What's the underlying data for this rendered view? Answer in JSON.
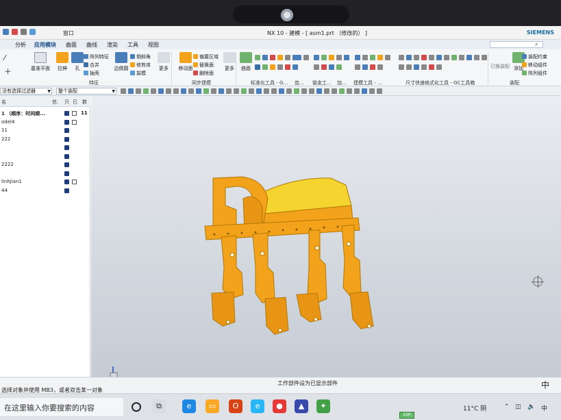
{
  "window": {
    "window_menu": "窗口",
    "title": "NX 10 - 建模 - [ asm1.prt （修改的） ]",
    "brand": "SIEMENS"
  },
  "menubar": {
    "items": [
      "分析",
      "应用模块",
      "曲面",
      "曲线",
      "渲染",
      "工具",
      "视图"
    ],
    "active_index": 1
  },
  "ribbon": {
    "groups": [
      {
        "label": "特征"
      },
      {
        "label": "同步建模"
      },
      {
        "label": "标准化工具 - G..."
      },
      {
        "label": "齿..."
      },
      {
        "label": "钣金工..."
      },
      {
        "label": "加..."
      },
      {
        "label": "建模工具 - ..."
      },
      {
        "label": "尺寸快速格式化工具 - GC工具箱"
      },
      {
        "label": "装配"
      }
    ],
    "feature_big": [
      {
        "label": "基准平面",
        "icon": "datum-plane-icon"
      },
      {
        "label": "拉伸",
        "icon": "extrude-icon"
      },
      {
        "label": "孔",
        "icon": "hole-icon"
      }
    ],
    "feature_small": [
      "阵列特征",
      "合并",
      "抽壳"
    ],
    "feature_small2": [
      "边倒圆"
    ],
    "feature_small3": [
      "倒斜角",
      "修剪体",
      "拔模"
    ],
    "more_label": "更多",
    "sync": {
      "big": "移动面",
      "small": [
        "偏置区域",
        "替换面",
        "删除面"
      ],
      "more": "更多"
    },
    "surface_label": "曲面",
    "assembly_small": [
      "装配约束",
      "移动组件",
      "阵列组件"
    ],
    "assembly_big": [
      "已换装配",
      "添加"
    ]
  },
  "selection_bar": {
    "filter_combo": "没有选择过滤器",
    "scope_combo": "整个装配"
  },
  "navigator": {
    "headers": [
      "名",
      "信.",
      "只",
      "已",
      "数"
    ],
    "rows": [
      {
        "name": "1 （顺序：时间顺...",
        "bold": true,
        "c3": "11"
      },
      {
        "name": "odel4",
        "bold": false,
        "c3": ""
      },
      {
        "name": "11",
        "bold": false,
        "c3": ""
      },
      {
        "name": "222",
        "bold": false,
        "c3": ""
      },
      {
        "name": "",
        "bold": false,
        "c3": ""
      },
      {
        "name": "",
        "bold": false,
        "c3": ""
      },
      {
        "name": "2222",
        "bold": false,
        "c3": ""
      },
      {
        "name": "",
        "bold": false,
        "c3": ""
      },
      {
        "name": "linhjian1",
        "bold": false,
        "c3": ""
      },
      {
        "name": "44",
        "bold": false,
        "c3": ""
      }
    ]
  },
  "status": {
    "prompt": "选择对象并使用 MB3，或者双击某一对象",
    "message": "工作部件设为已显示部件",
    "ime_lang": "中"
  },
  "taskbar": {
    "search_placeholder": "在这里输入你要搜索的内容",
    "battery": "100",
    "weather": "11°C 阴",
    "colors": {
      "accent": "#1a4f86",
      "model": "#f2a21b",
      "model_top": "#f6d430"
    }
  }
}
